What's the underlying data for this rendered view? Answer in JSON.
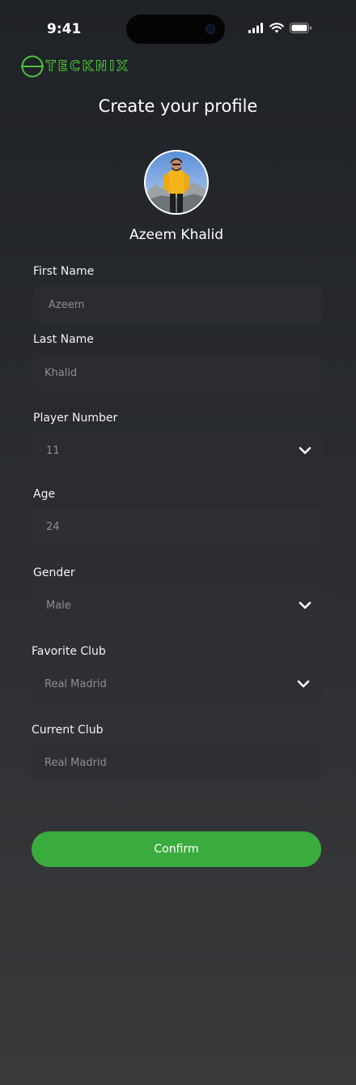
{
  "status_bar": {
    "time": "9:41"
  },
  "logo": {
    "text": "TECKNIX"
  },
  "page": {
    "title": "Create your profile"
  },
  "profile": {
    "name": "Azeem Khalid"
  },
  "form": {
    "first_name": {
      "label": "First Name",
      "value": "Azeem"
    },
    "last_name": {
      "label": "Last Name",
      "value": "Khalid"
    },
    "player_number": {
      "label": "Player Number",
      "value": "11"
    },
    "age": {
      "label": "Age",
      "value": "24"
    },
    "gender": {
      "label": "Gender",
      "value": "Male"
    },
    "favorite_club": {
      "label": "Favorite Club",
      "value": "Real Madrid"
    },
    "current_club": {
      "label": "Current Club",
      "value": "Real Madrid"
    }
  },
  "actions": {
    "confirm_label": "Confirm"
  },
  "colors": {
    "accent": "#3aac3e",
    "logo": "#4cc13d",
    "field": "#2b2c2f"
  },
  "icons": [
    "signal-icon",
    "wifi-icon",
    "battery-icon",
    "chevron-down-icon"
  ]
}
